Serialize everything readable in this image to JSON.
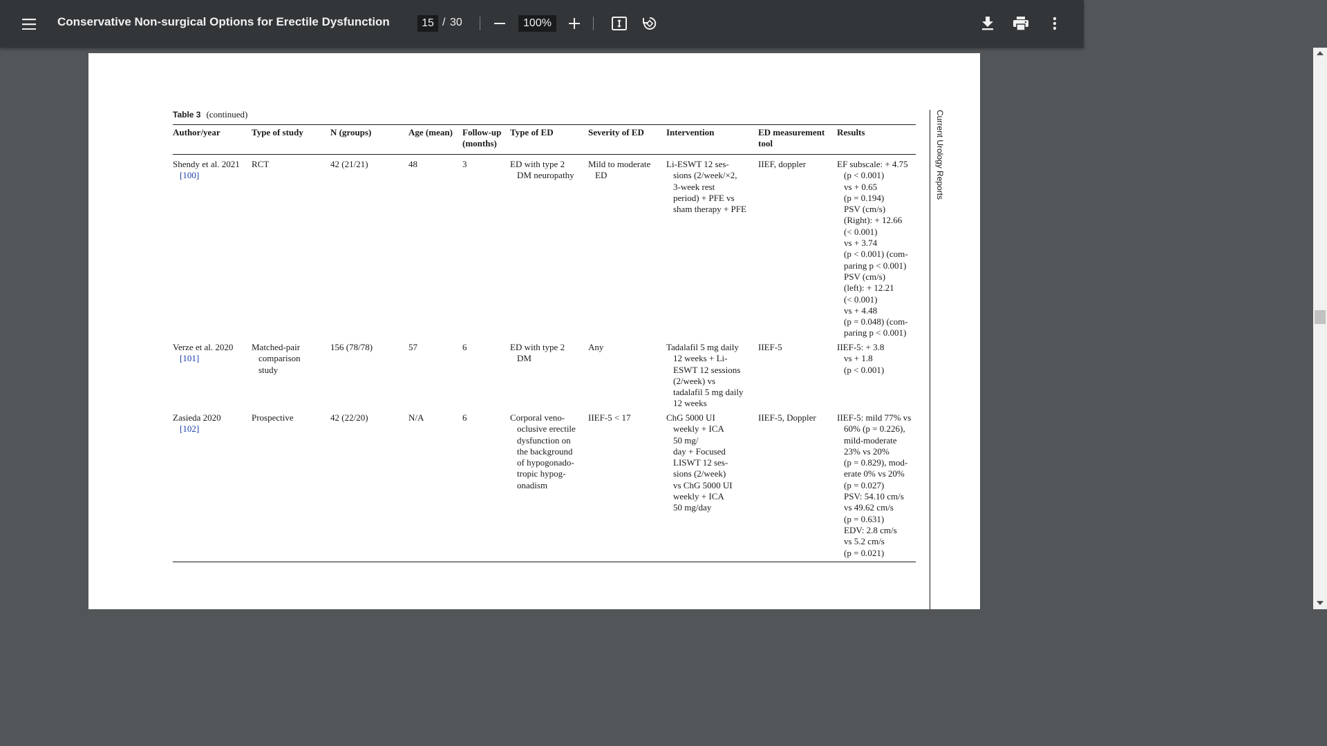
{
  "toolbar": {
    "title": "Conservative Non-surgical Options for Erectile Dysfunction",
    "current_page": "15",
    "page_separator": "/",
    "total_pages": "30",
    "zoom": "100%",
    "icons": {
      "menu": "menu-icon",
      "zoom_out": "minus-icon",
      "zoom_in": "plus-icon",
      "fit": "fit-page-icon",
      "rotate": "rotate-icon",
      "download": "download-icon",
      "print": "print-icon",
      "more": "more-vert-icon"
    }
  },
  "document": {
    "caption_label": "Table 3",
    "caption_text": "(continued)",
    "running_head": "Current Urology Reports",
    "headers": [
      [
        "Author/year"
      ],
      [
        "Type of study"
      ],
      [
        "N (groups)"
      ],
      [
        "Age (mean)"
      ],
      [
        "Follow-up",
        "(months)"
      ],
      [
        "Type of ED"
      ],
      [
        "Severity of ED"
      ],
      [
        "Intervention"
      ],
      [
        "ED measurement",
        "tool"
      ],
      [
        "Results"
      ]
    ],
    "rows": [
      {
        "author": [
          "Shendy et al. 2021",
          "[100]"
        ],
        "study": [
          "RCT"
        ],
        "n": [
          "42 (21/21)"
        ],
        "age": [
          "48"
        ],
        "followup": [
          "3"
        ],
        "type_ed": [
          "ED with type 2",
          "DM neuropathy"
        ],
        "severity": [
          "Mild to moderate",
          "ED"
        ],
        "intervention": [
          "Li-ESWT 12 ses-",
          "sions (2/week/×2,",
          "3-week rest",
          "period) + PFE vs",
          "sham therapy + PFE"
        ],
        "tool": [
          "IIEF, doppler"
        ],
        "results": [
          "EF subscale: + 4.75",
          "(p < 0.001)",
          "vs + 0.65",
          "(p = 0.194)",
          "PSV (cm/s)",
          "(Right): + 12.66",
          "(< 0.001)",
          "vs + 3.74",
          "(p < 0.001) (com-",
          "paring p < 0.001)",
          "PSV (cm/s)",
          "(left): + 12.21",
          "(< 0.001)",
          "vs + 4.48",
          "(p = 0.048) (com-",
          "paring p < 0.001)"
        ]
      },
      {
        "author": [
          "Verze et al. 2020",
          "[101]"
        ],
        "study": [
          "Matched-pair",
          "comparison",
          "study"
        ],
        "n": [
          "156 (78/78)"
        ],
        "age": [
          "57"
        ],
        "followup": [
          "6"
        ],
        "type_ed": [
          "ED with type 2",
          "DM"
        ],
        "severity": [
          "Any"
        ],
        "intervention": [
          "Tadalafil 5 mg daily",
          "12 weeks + Li-",
          "ESWT 12 sessions",
          "(2/week) vs",
          "tadalafil 5 mg daily",
          "12 weeks"
        ],
        "tool": [
          "IIEF-5"
        ],
        "results": [
          "IIEF-5: + 3.8",
          "vs + 1.8",
          "(p < 0.001)"
        ]
      },
      {
        "author": [
          "Zasieda 2020",
          "[102]"
        ],
        "study": [
          "Prospective"
        ],
        "n": [
          "42 (22/20)"
        ],
        "age": [
          "N/A"
        ],
        "followup": [
          "6"
        ],
        "type_ed": [
          "Corporal veno-",
          "oclusive erectile",
          "dysfunction on",
          "the background",
          "of hypogonado-",
          "tropic hypog-",
          "onadism"
        ],
        "severity": [
          "IIEF-5 < 17"
        ],
        "intervention": [
          "ChG 5000 UI",
          "weekly + ICA",
          "50 mg/",
          "day + Focused",
          "LISWT 12 ses-",
          "sions (2/week)",
          "vs ChG 5000 UI",
          "weekly + ICA",
          "50 mg/day"
        ],
        "tool": [
          "IIEF-5, Doppler"
        ],
        "results": [
          "IIEF-5: mild 77% vs",
          "60% (p = 0.226),",
          "mild-moderate",
          "23% vs 20%",
          "(p = 0.829), mod-",
          "erate 0% vs 20%",
          "(p = 0.027)",
          "PSV: 54.10 cm/s",
          "vs 49.62 cm/s",
          "(p = 0.631)",
          "EDV: 2.8 cm/s",
          "vs 5.2 cm/s",
          "(p = 0.021)"
        ]
      }
    ]
  }
}
